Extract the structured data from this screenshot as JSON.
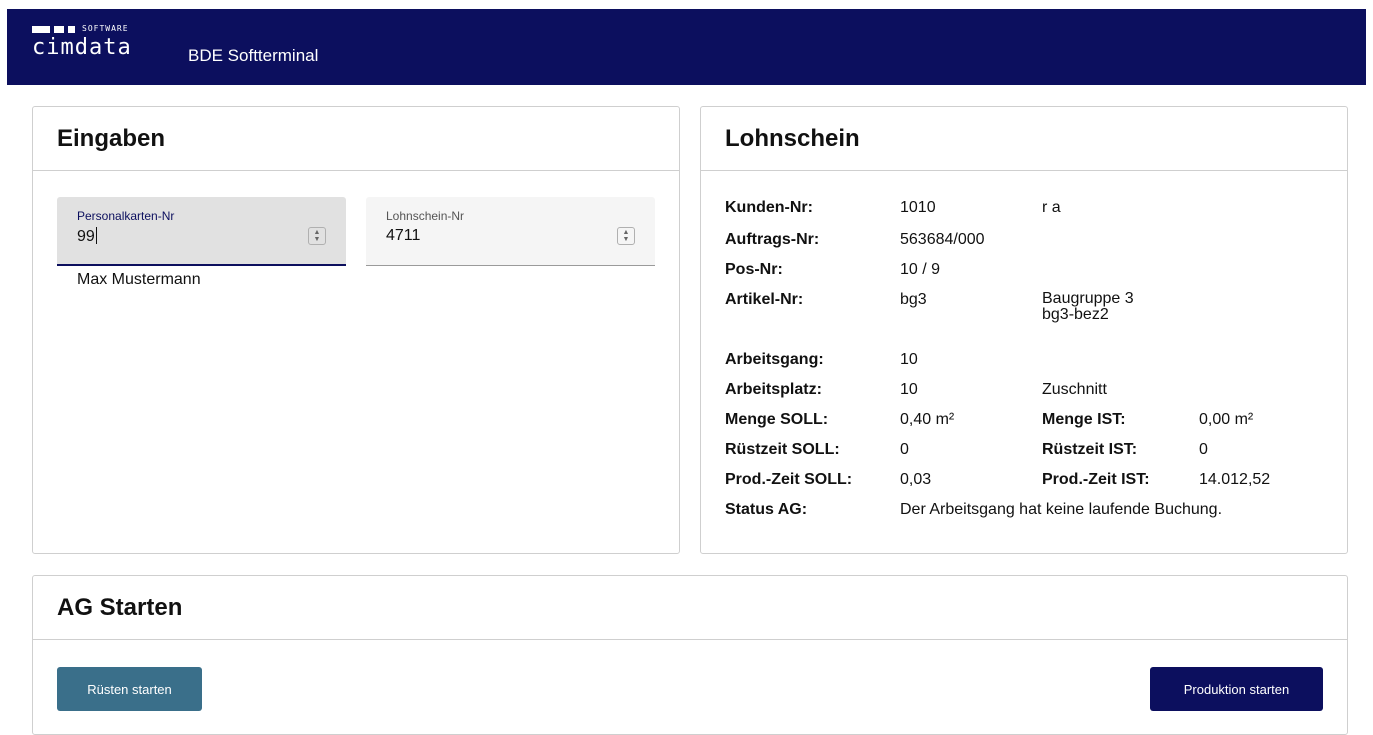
{
  "app": {
    "logo_tagline": "SOFTWARE",
    "logo_word": "cimdata",
    "title": "BDE Softterminal"
  },
  "inputs": {
    "title": "Eingaben",
    "personalkarte": {
      "label": "Personalkarten-Nr",
      "value": "99"
    },
    "lohnschein": {
      "label": "Lohnschein-Nr",
      "value": "4711"
    },
    "person_name": "Max Mustermann"
  },
  "lohnschein": {
    "title": "Lohnschein",
    "kunden_nr": {
      "label": "Kunden-Nr:",
      "value": "1010",
      "extra": "r a"
    },
    "auftrags_nr": {
      "label": "Auftrags-Nr:",
      "value": "563684/000"
    },
    "pos_nr": {
      "label": "Pos-Nr:",
      "value": "10 / 9"
    },
    "artikel_nr": {
      "label": "Artikel-Nr:",
      "value": "bg3",
      "extra_line1": "Baugruppe 3",
      "extra_line2": "bg3-bez2"
    },
    "arbeitsgang": {
      "label": "Arbeitsgang:",
      "value": "10"
    },
    "arbeitsplatz": {
      "label": "Arbeitsplatz:",
      "value": "10",
      "extra": "Zuschnitt"
    },
    "menge": {
      "soll_label": "Menge SOLL:",
      "soll_value": "0,40 m²",
      "ist_label": "Menge IST:",
      "ist_value": "0,00 m²"
    },
    "ruestzeit": {
      "soll_label": "Rüstzeit SOLL:",
      "soll_value": "0",
      "ist_label": "Rüstzeit IST:",
      "ist_value": "0"
    },
    "prodzeit": {
      "soll_label": "Prod.-Zeit SOLL:",
      "soll_value": "0,03",
      "ist_label": "Prod.-Zeit IST:",
      "ist_value": "14.012,52"
    },
    "status": {
      "label": "Status AG:",
      "value": "Der Arbeitsgang hat keine laufende Buchung."
    }
  },
  "ag": {
    "title": "AG Starten",
    "ruesten_label": "Rüsten starten",
    "produktion_label": "Produktion starten"
  },
  "colors": {
    "header_bg": "#0c0f5e",
    "ruesten_button": "#3a6f8a",
    "produktion_button": "#0c0f5e"
  }
}
